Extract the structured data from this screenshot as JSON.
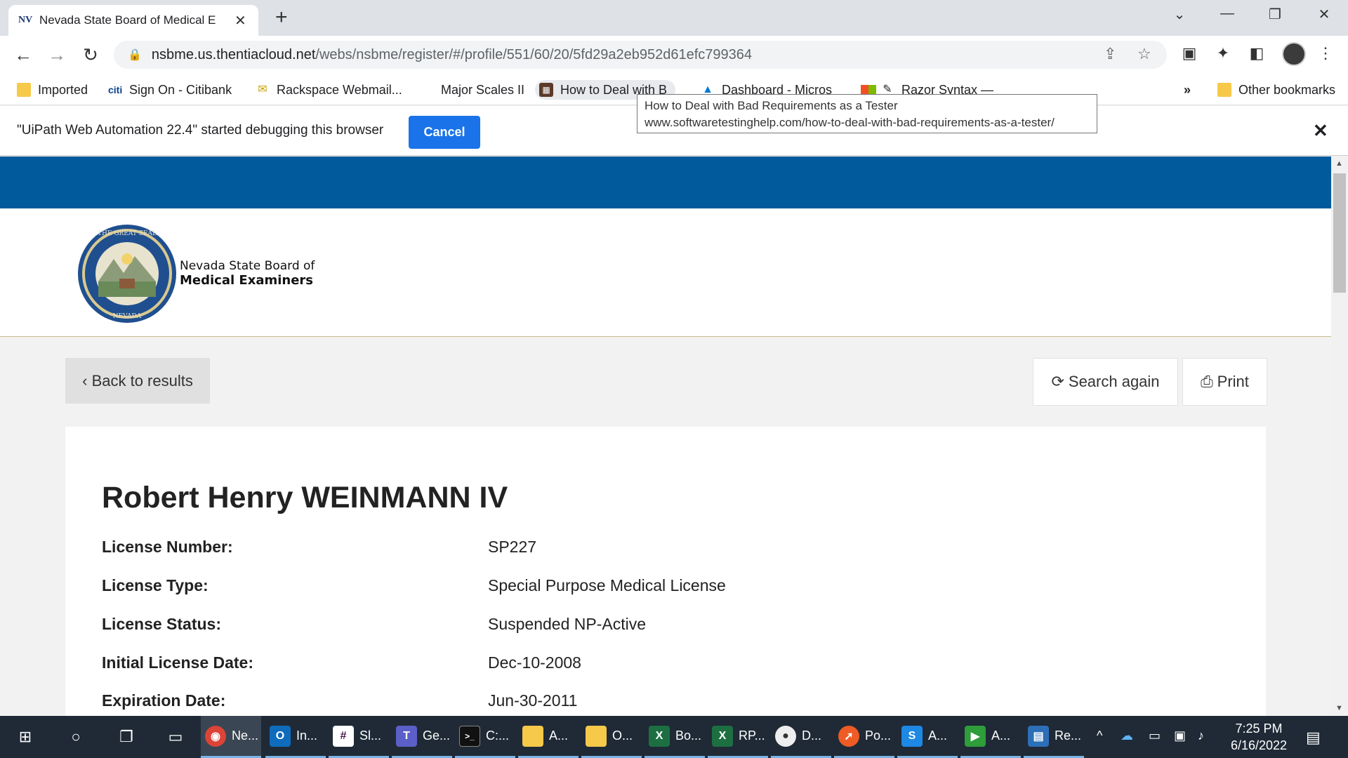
{
  "browser": {
    "tab": {
      "favicon": "NV",
      "title": "Nevada State Board of Medical E"
    },
    "url_host": "nsbme.us.thentiacloud.net",
    "url_path": "/webs/nsbme/register/#/profile/551/60/20/5fd29a2eb952d61efc799364"
  },
  "bookmarks": [
    {
      "label": "Imported",
      "icon": "folder-icon"
    },
    {
      "label": "Sign On - Citibank",
      "icon": "citi-icon"
    },
    {
      "label": "Rackspace Webmail...",
      "icon": "mail-icon"
    },
    {
      "label": "Major Scales II",
      "icon": "none"
    },
    {
      "label": "How to Deal with B",
      "icon": "site-icon"
    },
    {
      "label": "Dashboard - Micros",
      "icon": "azure-icon"
    },
    {
      "label": "Razor Syntax —",
      "icon": "pen-icon"
    },
    {
      "label": "»",
      "icon": "none"
    },
    {
      "label": "Other bookmarks",
      "icon": "folder-icon"
    }
  ],
  "tooltip": {
    "title": "How to Deal with Bad Requirements as a Tester",
    "url": "www.softwaretestinghelp.com/how-to-deal-with-bad-requirements-as-a-tester/"
  },
  "infobar": {
    "message": "\"UiPath Web Automation 22.4\" started debugging this browser",
    "cancel_label": "Cancel"
  },
  "site": {
    "org_line1": "Nevada State Board of",
    "org_line2": "Medical Examiners"
  },
  "actions": {
    "back_label": "Back to results",
    "search_again_label": "Search again",
    "print_label": "Print"
  },
  "profile": {
    "name": "Robert Henry WEINMANN IV",
    "fields": [
      {
        "label": "License Number:",
        "value": "SP227"
      },
      {
        "label": "License Type:",
        "value": "Special Purpose Medical License"
      },
      {
        "label": "License Status:",
        "value": "Suspended NP-Active"
      },
      {
        "label": "Initial License Date:",
        "value": "Dec-10-2008"
      },
      {
        "label": "Expiration Date:",
        "value": "Jun-30-2011"
      }
    ]
  },
  "taskbar": {
    "apps": [
      {
        "label": "Ne...",
        "icon": "chrome-icon",
        "color": "#db4437"
      },
      {
        "label": "In...",
        "icon": "outlook-icon",
        "color": "#0f6cbd"
      },
      {
        "label": "Sl...",
        "icon": "slack-icon",
        "color": "#4a154b"
      },
      {
        "label": "Ge...",
        "icon": "teams-icon",
        "color": "#5b5fc7"
      },
      {
        "label": "C:...",
        "icon": "terminal-icon",
        "color": "#111111"
      },
      {
        "label": "A...",
        "icon": "folder-icon",
        "color": "#f6c94a"
      },
      {
        "label": "O...",
        "icon": "folder-icon",
        "color": "#f6c94a"
      },
      {
        "label": "Bo...",
        "icon": "excel-icon",
        "color": "#1d6f42"
      },
      {
        "label": "RP...",
        "icon": "excel-icon",
        "color": "#1d6f42"
      },
      {
        "label": "D...",
        "icon": "app-icon",
        "color": "#555555"
      },
      {
        "label": "Po...",
        "icon": "postman-icon",
        "color": "#ef5b25"
      },
      {
        "label": "A...",
        "icon": "app-icon",
        "color": "#1e88e5"
      },
      {
        "label": "A...",
        "icon": "play-icon",
        "color": "#2e9d3a"
      },
      {
        "label": "Re...",
        "icon": "remote-desktop-icon",
        "color": "#2d6fb7"
      }
    ],
    "time": "7:25 PM",
    "date": "6/16/2022"
  }
}
